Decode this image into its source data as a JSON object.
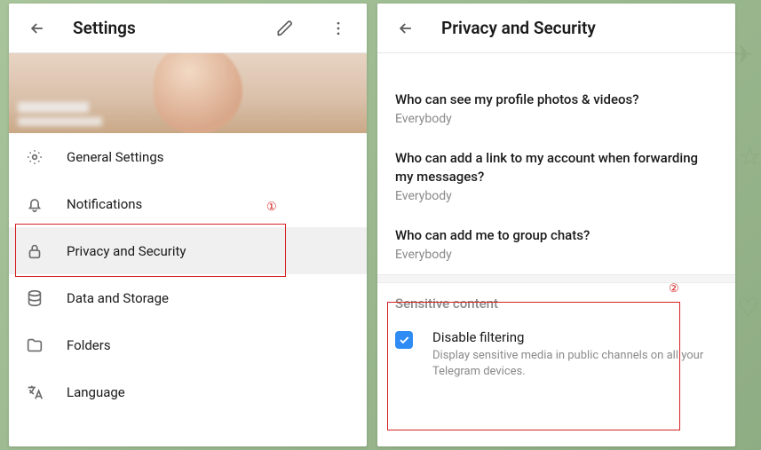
{
  "left": {
    "title": "Settings",
    "menu": [
      {
        "label": "General Settings"
      },
      {
        "label": "Notifications"
      },
      {
        "label": "Privacy and Security"
      },
      {
        "label": "Data and Storage"
      },
      {
        "label": "Folders"
      },
      {
        "label": "Language"
      }
    ]
  },
  "right": {
    "title": "Privacy and Security",
    "privacy_items": [
      {
        "title": "Who can see my profile photos & videos?",
        "value": "Everybody"
      },
      {
        "title": "Who can add a link to my account when forwarding my messages?",
        "value": "Everybody"
      },
      {
        "title": "Who can add me to group chats?",
        "value": "Everybody"
      }
    ],
    "sensitive": {
      "header": "Sensitive content",
      "item": {
        "title": "Disable filtering",
        "desc": "Display sensitive media in public channels on all your Telegram devices.",
        "checked": true
      }
    }
  },
  "annotations": {
    "a1": "①",
    "a2": "②"
  }
}
